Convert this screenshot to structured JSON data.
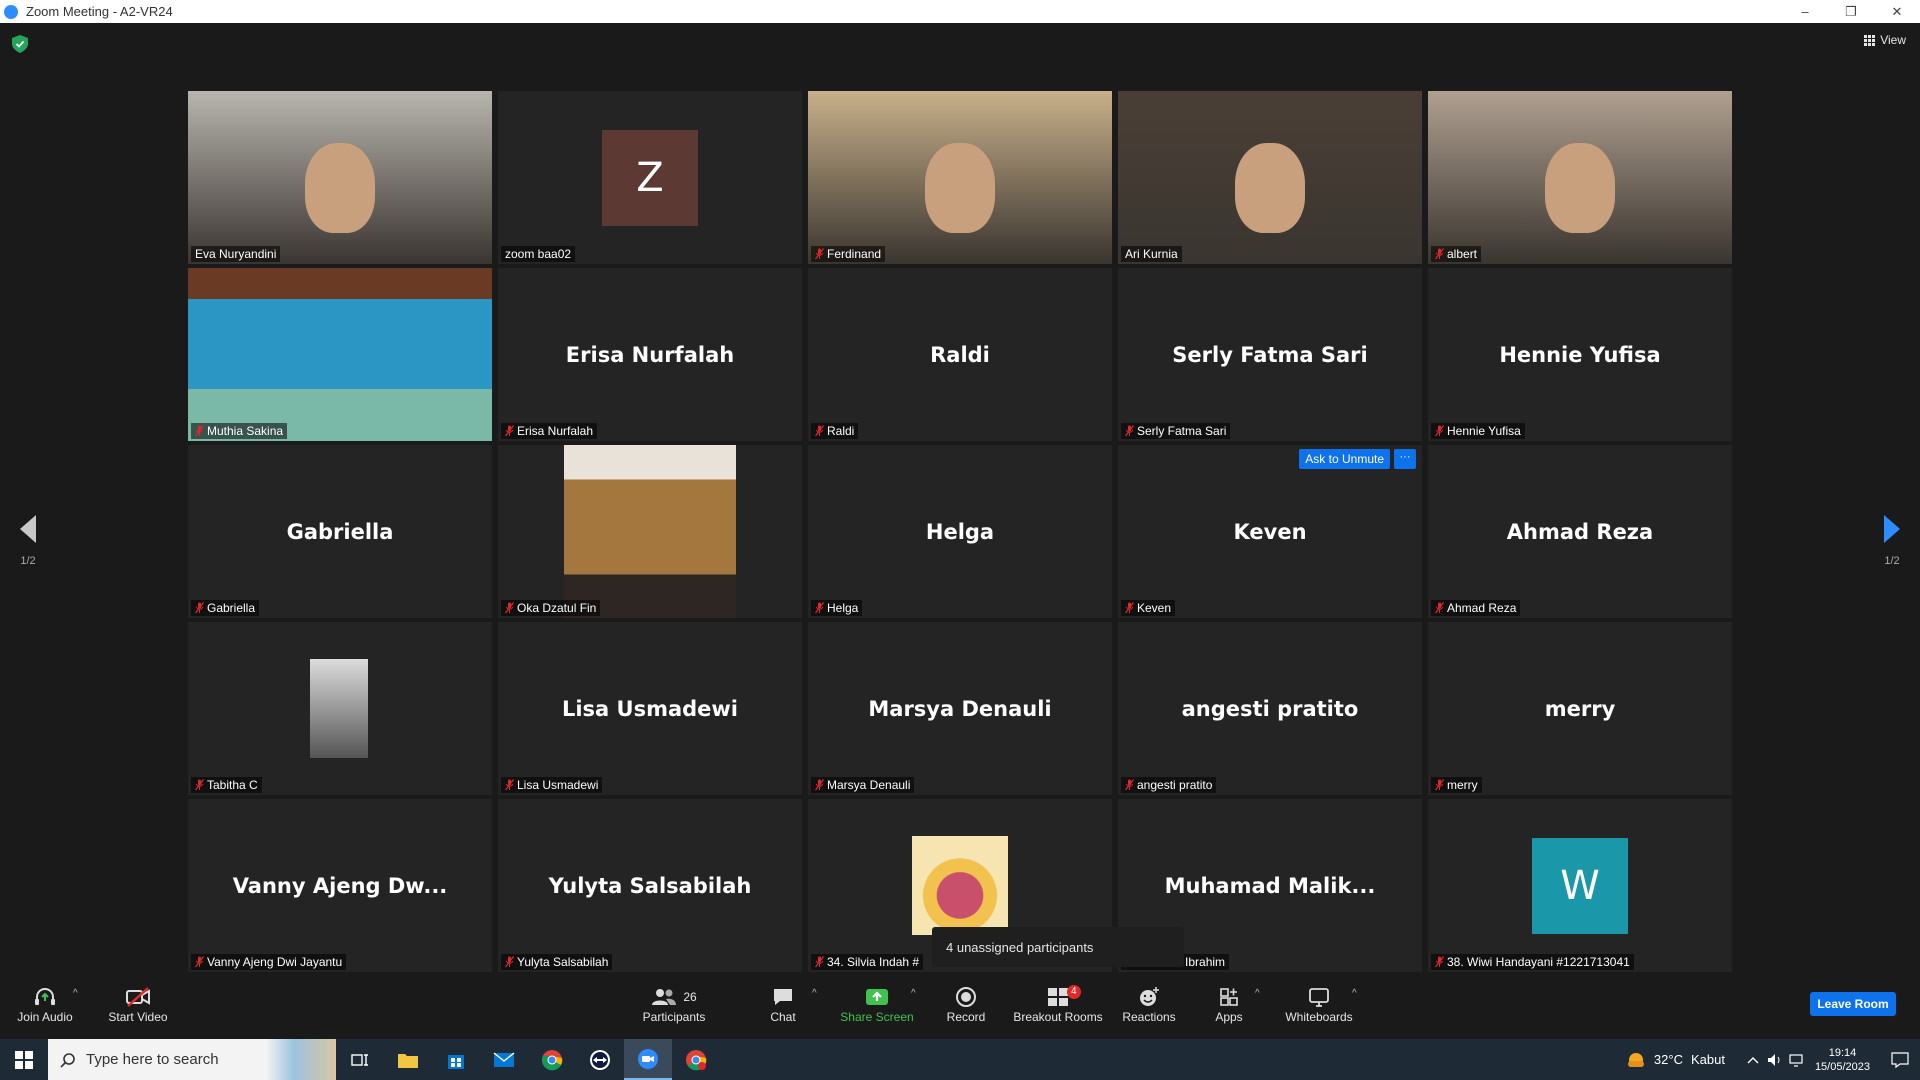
{
  "window": {
    "title": "Zoom Meeting - A2-VR24",
    "minimize": "–",
    "maximize": "❐",
    "close": "✕"
  },
  "view": {
    "label": "View"
  },
  "pager": {
    "left": "1/2",
    "right": "1/2"
  },
  "tiles": [
    {
      "label": "Eva Nuryandini",
      "muted": false,
      "type": "video"
    },
    {
      "label": "zoom baa02",
      "muted": false,
      "type": "initial",
      "initial": "Z",
      "initial_color": "#5c3a33"
    },
    {
      "label": "Ferdinand",
      "muted": true,
      "type": "video"
    },
    {
      "label": "Ari Kurnia",
      "muted": false,
      "type": "video",
      "active_speaker": true
    },
    {
      "label": "albert",
      "muted": true,
      "type": "video"
    },
    {
      "label": "Muthia Sakina",
      "muted": true,
      "type": "image"
    },
    {
      "label": "Erisa Nurfalah",
      "muted": true,
      "type": "name",
      "display_name": "Erisa Nurfalah"
    },
    {
      "label": "Raldi",
      "muted": true,
      "type": "name",
      "display_name": "Raldi"
    },
    {
      "label": "Serly Fatma Sari",
      "muted": true,
      "type": "name",
      "display_name": "Serly Fatma Sari"
    },
    {
      "label": "Hennie Yufisa",
      "muted": true,
      "type": "name",
      "display_name": "Hennie Yufisa"
    },
    {
      "label": "Gabriella",
      "muted": true,
      "type": "name",
      "display_name": "Gabriella"
    },
    {
      "label": "Oka Dzatul Fin",
      "muted": true,
      "type": "image"
    },
    {
      "label": "Helga",
      "muted": true,
      "type": "name",
      "display_name": "Helga"
    },
    {
      "label": "Keven",
      "muted": true,
      "type": "name",
      "display_name": "Keven",
      "ask_unmute": "Ask to Unmute",
      "more": "···"
    },
    {
      "label": "Ahmad Reza",
      "muted": true,
      "type": "name",
      "display_name": "Ahmad Reza"
    },
    {
      "label": "Tabitha C",
      "muted": true,
      "type": "image"
    },
    {
      "label": "Lisa Usmadewi",
      "muted": true,
      "type": "name",
      "display_name": "Lisa Usmadewi"
    },
    {
      "label": "Marsya Denauli",
      "muted": true,
      "type": "name",
      "display_name": "Marsya Denauli"
    },
    {
      "label": "angesti pratito",
      "muted": true,
      "type": "name",
      "display_name": "angesti pratito"
    },
    {
      "label": "merry",
      "muted": true,
      "type": "name",
      "display_name": "merry"
    },
    {
      "label": "Vanny Ajeng Dwi Jayantu",
      "muted": true,
      "type": "name",
      "display_name": "Vanny Ajeng Dw..."
    },
    {
      "label": "Yulyta Salsabilah",
      "muted": true,
      "type": "name",
      "display_name": "Yulyta Salsabilah"
    },
    {
      "label": "34. Silvia Indah #",
      "muted": true,
      "type": "image"
    },
    {
      "label": "ad Malik Ibrahim",
      "muted": true,
      "type": "name",
      "display_name": "Muhamad  Malik..."
    },
    {
      "label": "38. Wiwi Handayani #1221713041",
      "muted": true,
      "type": "initial",
      "initial": "W",
      "initial_color": "#1a97a8"
    }
  ],
  "tooltip": "4 unassigned participants",
  "toolbar": {
    "join_audio": "Join Audio",
    "start_video": "Start Video",
    "participants": "Participants",
    "participants_count": "26",
    "chat": "Chat",
    "share_screen": "Share Screen",
    "record": "Record",
    "breakout_rooms": "Breakout Rooms",
    "breakout_badge": "4",
    "reactions": "Reactions",
    "apps": "Apps",
    "whiteboards": "Whiteboards",
    "leave_room": "Leave Room",
    "caret": "^"
  },
  "taskbar": {
    "search_placeholder": "Type here to search",
    "weather_temp": "32°C",
    "weather_desc": "Kabut",
    "time": "19:14",
    "date": "15/05/2023"
  },
  "colors": {
    "accent": "#0e72ed",
    "active_speaker": "#e5e57a",
    "share_green": "#40c24f",
    "mute_red": "#e02828"
  }
}
